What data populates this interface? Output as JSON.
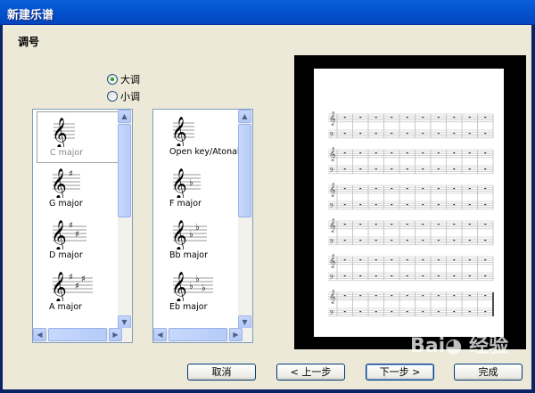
{
  "window": {
    "title": "新建乐谱"
  },
  "section_title": "调号",
  "mode": {
    "options": [
      {
        "label": "大调",
        "selected": true
      },
      {
        "label": "小调",
        "selected": false
      }
    ]
  },
  "list_sharps": {
    "items": [
      {
        "label": "C major",
        "sharps": 0,
        "selected": true
      },
      {
        "label": "G major",
        "sharps": 1
      },
      {
        "label": "D major",
        "sharps": 2
      },
      {
        "label": "A major",
        "sharps": 3
      }
    ]
  },
  "list_flats": {
    "items": [
      {
        "label": "Open key/Atonal",
        "flats": 0
      },
      {
        "label": "F major",
        "flats": 1
      },
      {
        "label": "Bb major",
        "flats": 2
      },
      {
        "label": "Eb major",
        "flats": 3
      }
    ]
  },
  "preview": {
    "systems": 6,
    "measures_per_system": 10
  },
  "buttons": {
    "cancel": "取消",
    "back": "< 上一步",
    "next": "下一步 >",
    "finish": "完成"
  },
  "watermark": "Bai 经验"
}
